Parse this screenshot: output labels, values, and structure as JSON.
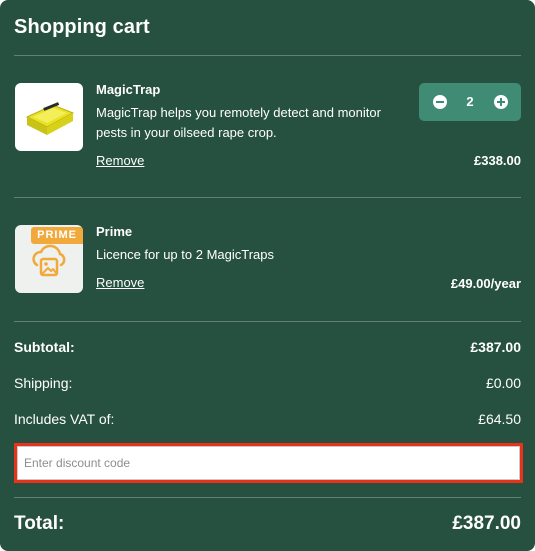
{
  "cart": {
    "title": "Shopping cart"
  },
  "items": [
    {
      "name": "MagicTrap",
      "description": "MagicTrap helps you remotely detect and monitor pests in your oilseed rape crop.",
      "remove_label": "Remove",
      "price": "£338.00",
      "quantity": "2",
      "image_icon": "magictrap-product-image"
    },
    {
      "name": "Prime",
      "badge": "PRIME",
      "description": "Licence for up to 2 MagicTraps",
      "remove_label": "Remove",
      "price": "£49.00/year",
      "image_icon": "image-placeholder-icon"
    }
  ],
  "summary": {
    "subtotal_label": "Subtotal:",
    "subtotal_value": "£387.00",
    "shipping_label": "Shipping:",
    "shipping_value": "£0.00",
    "vat_label": "Includes VAT of:",
    "vat_value": "£64.50"
  },
  "discount": {
    "placeholder": "Enter discount code",
    "value": ""
  },
  "total": {
    "label": "Total:",
    "value": "£387.00"
  },
  "colors": {
    "panel": "#26503f",
    "stepper": "#3f8b73",
    "prime_badge": "#f2a93b",
    "highlight": "#e8321a"
  }
}
